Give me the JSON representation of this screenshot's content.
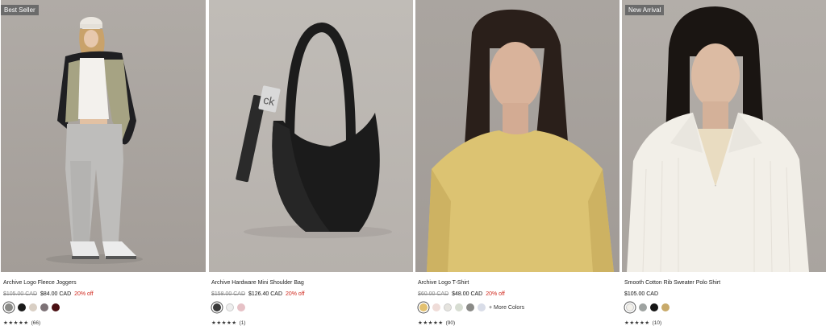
{
  "products": [
    {
      "badge": "Best Seller",
      "name": "Archive Logo Fleece Joggers",
      "orig_price": "$105.00 CAD",
      "price": "$84.00 CAD",
      "discount": "20% off",
      "swatches": [
        "#8a8a87",
        "#1a1a1a",
        "#d9cfc4",
        "#7d7276",
        "#4a0f12"
      ],
      "stars": "★★★★★",
      "reviews": "(66)",
      "image_icon": "joggers-model-photo"
    },
    {
      "badge": "",
      "name": "Archive Hardware Mini Shoulder Bag",
      "orig_price": "$158.00 CAD",
      "price": "$126.40 CAD",
      "discount": "20% off",
      "swatches": [
        "#3a3a3a",
        "#eeeeee",
        "#e6c1c6"
      ],
      "stars": "★★★★★",
      "reviews": "(1)",
      "image_icon": "shoulder-bag-photo"
    },
    {
      "badge": "",
      "name": "Archive Logo T-Shirt",
      "orig_price": "$60.00 CAD",
      "price": "$48.00 CAD",
      "discount": "20% off",
      "swatches": [
        "#e3c170",
        "#efdcd8",
        "#e5e3de",
        "#d7ddd2",
        "#8a8a87",
        "#d9dde8"
      ],
      "more": "+ More Colors",
      "stars": "★★★★★",
      "reviews": "(90)",
      "image_icon": "tshirt-model-photo"
    },
    {
      "badge": "New Arrival",
      "name": "Smooth Cotton Rib Sweater Polo Shirt",
      "orig_price": "",
      "price": "$105.00 CAD",
      "discount": "",
      "swatches": [
        "#f2f0ea",
        "#9ea3a1",
        "#151515",
        "#c8aa6a"
      ],
      "stars": "★★★★★",
      "reviews": "(10)",
      "image_icon": "polo-model-photo"
    }
  ]
}
